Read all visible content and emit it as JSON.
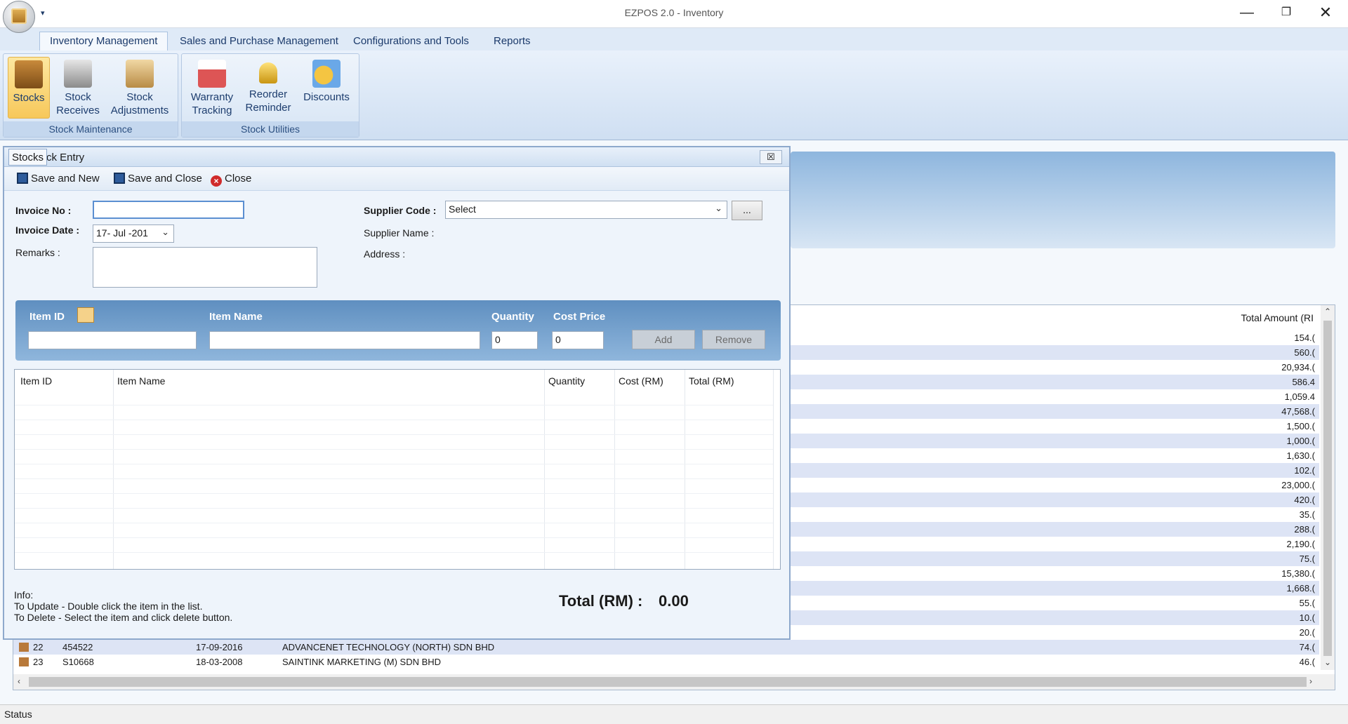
{
  "app": {
    "title": "EZPOS 2.0 - Inventory",
    "window": {
      "minimize": "—",
      "maximize": "❐",
      "close": "✕"
    },
    "quick_access_arrow": "▾"
  },
  "ribbon": {
    "tabs": [
      "Inventory Management",
      "Sales and Purchase Management",
      "Configurations and Tools",
      "Reports"
    ],
    "groups": {
      "stock_maintenance": {
        "label": "Stock Maintenance",
        "buttons": [
          {
            "line1": "Stocks",
            "line2": "",
            "icon": "box-icon"
          },
          {
            "line1": "Stock",
            "line2": "Receives",
            "icon": "warehouse-icon"
          },
          {
            "line1": "Stock",
            "line2": "Adjustments",
            "icon": "note-pencil-icon"
          }
        ]
      },
      "stock_utilities": {
        "label": "Stock Utilities",
        "buttons": [
          {
            "line1": "Warranty",
            "line2": "Tracking",
            "icon": "calendar-icon"
          },
          {
            "line1": "Reorder",
            "line2": "Reminder",
            "icon": "bell-icon"
          },
          {
            "line1": "Discounts",
            "line2": "",
            "icon": "coins-icon"
          }
        ]
      }
    }
  },
  "dialog": {
    "tab_label": "Stocks",
    "title": "ck Entry",
    "close_glyph": "☒",
    "toolbar": {
      "save_new": "Save and  New",
      "save_close": "Save and Close",
      "close": "Close"
    },
    "form": {
      "invoice_no_label": "Invoice No :",
      "invoice_no_value": "",
      "invoice_date_label": "Invoice Date :",
      "invoice_date_value": "17- Jul -201",
      "remarks_label": "Remarks :",
      "supplier_code_label": "Supplier Code :",
      "supplier_code_value": "Select",
      "supplier_name_label": "Supplier Name :",
      "address_label": "Address :",
      "browse_label": "..."
    },
    "item_entry": {
      "item_id_label": "Item ID",
      "item_name_label": "Item Name",
      "quantity_label": "Quantity",
      "cost_price_label": "Cost Price",
      "quantity_value": "0",
      "cost_price_value": "0",
      "add_label": "Add",
      "remove_label": "Remove"
    },
    "list_columns": [
      "Item ID",
      "Item Name",
      "Quantity",
      "Cost (RM)",
      "Total (RM)"
    ],
    "info": {
      "title": "Info:",
      "line1": "To Update - Double click the item in the list.",
      "line2": "To Delete - Select the item and click delete button."
    },
    "total_label": "Total (RM) :",
    "total_value": "0.00"
  },
  "background_grid": {
    "total_header": "Total Amount (RI",
    "amounts": [
      "154.(",
      "560.(",
      "20,934.(",
      "586.4",
      "1,059.4",
      "47,568.(",
      "1,500.(",
      "1,000.(",
      "1,630.(",
      "102.(",
      "23,000.(",
      "420.(",
      "35.(",
      "288.(",
      "2,190.(",
      "75.(",
      "15,380.(",
      "1,668.(",
      "55.(",
      "10.(",
      "20.(",
      "74.(",
      "46.("
    ],
    "rows": [
      {
        "no": "22",
        "code": "454522",
        "date": "17-09-2016",
        "supplier": "ADVANCENET TECHNOLOGY (NORTH) SDN BHD"
      },
      {
        "no": "23",
        "code": "S10668",
        "date": "18-03-2008",
        "supplier": "SAINTINK MARKETING (M) SDN BHD"
      }
    ]
  },
  "status": "Status"
}
